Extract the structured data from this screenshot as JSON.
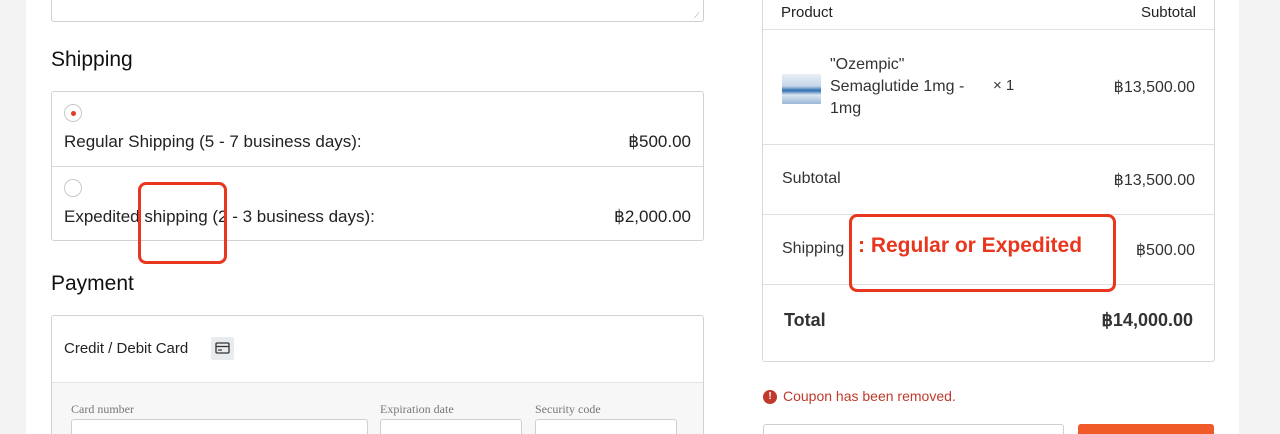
{
  "shipping": {
    "title": "Shipping",
    "options": [
      {
        "label": "Regular Shipping (5 - 7 business days):",
        "price": "฿500.00",
        "selected": true
      },
      {
        "label": "Expedited shipping (2 - 3 business days):",
        "price": "฿2,000.00",
        "selected": false
      }
    ]
  },
  "payment": {
    "title": "Payment",
    "method_label": "Credit / Debit Card",
    "method_icon": "credit-card-icon",
    "fields": {
      "card_number_label": "Card number",
      "expiration_label": "Expiration date",
      "security_label": "Security code"
    }
  },
  "order": {
    "header_product": "Product",
    "header_subtotal": "Subtotal",
    "item": {
      "name": "\"Ozempic\" Semaglutide 1mg - 1mg",
      "quantity": "× 1",
      "price": "฿13,500.00"
    },
    "subtotal_label": "Subtotal",
    "subtotal_value": "฿13,500.00",
    "shipping_label": "Shipping",
    "shipping_value": "฿500.00",
    "total_label": "Total",
    "total_value": "฿14,000.00"
  },
  "coupon": {
    "message": "Coupon has been removed.",
    "error_icon": "alert-circle-icon"
  },
  "annotation": {
    "text": ": Regular or Expedited",
    "color": "#e8371e"
  },
  "colors": {
    "accent": "#f05a28",
    "error": "#c0392b",
    "radio_dot": "#e23b2a"
  }
}
